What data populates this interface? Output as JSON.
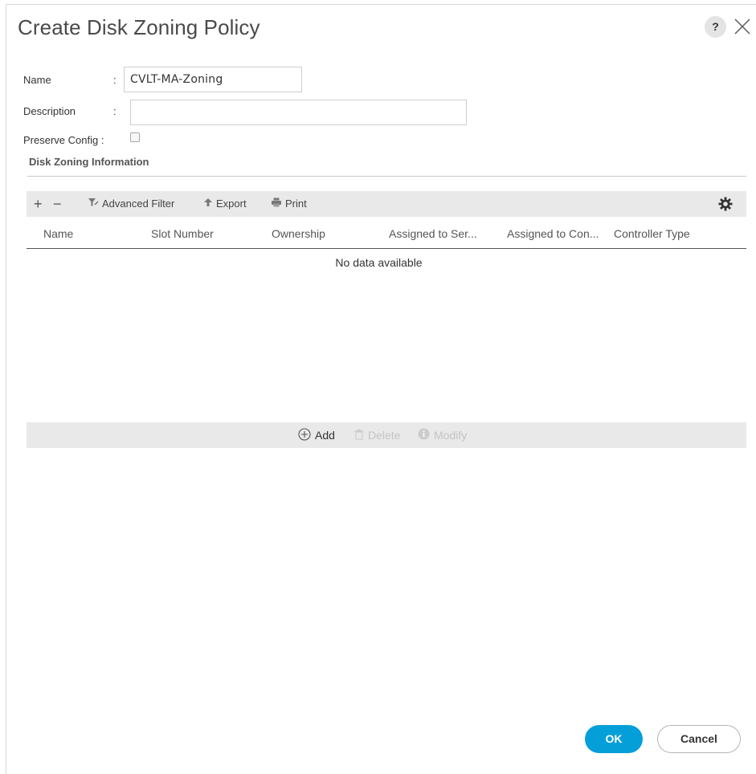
{
  "dialog": {
    "title": "Create Disk Zoning Policy",
    "help_label": "?"
  },
  "form": {
    "name_label": "Name",
    "name_value": "CVLT-MA-Zoning",
    "description_label": "Description",
    "description_value": "",
    "preserve_label": "Preserve Config :",
    "preserve_checked": false,
    "colon": ":"
  },
  "section": {
    "title": "Disk Zoning Information"
  },
  "toolbar": {
    "add_symbol": "+",
    "remove_symbol": "−",
    "advanced_filter_label": "Advanced Filter",
    "export_label": "Export",
    "print_label": "Print"
  },
  "table": {
    "columns": [
      "Name",
      "Slot Number",
      "Ownership",
      "Assigned to Ser...",
      "Assigned to Con...",
      "Controller Type"
    ],
    "empty_message": "No data available",
    "rows": []
  },
  "actions": {
    "add_label": "Add",
    "delete_label": "Delete",
    "modify_label": "Modify"
  },
  "footer": {
    "ok_label": "OK",
    "cancel_label": "Cancel"
  },
  "colors": {
    "accent": "#049fd9",
    "toolbar_bg": "#e9e9e9",
    "disabled_text": "#c4c4c4"
  }
}
